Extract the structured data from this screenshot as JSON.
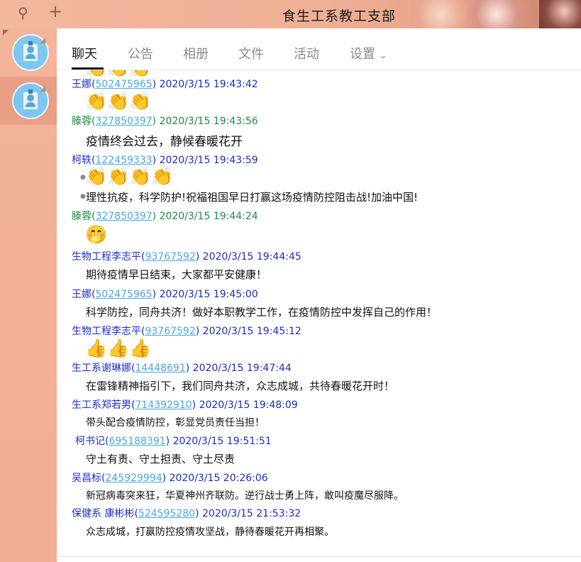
{
  "window": {
    "title": "食生工系教工支部"
  },
  "tools": {
    "search_icon": "⚲",
    "add_icon": "+"
  },
  "tabs": [
    {
      "label": "聊天"
    },
    {
      "label": "公告"
    },
    {
      "label": "相册"
    },
    {
      "label": "文件"
    },
    {
      "label": "活动"
    },
    {
      "label": "设置"
    }
  ],
  "messages": [
    {
      "sender": "王娜",
      "uid": "502475965",
      "time": "2020/3/15 19:43:42",
      "emoji": "👏👏👏"
    },
    {
      "sender": "滕蓉",
      "uid": "327850397",
      "time": "2020/3/15 19:43:56",
      "text": "疫情终会过去，静候春暖花开"
    },
    {
      "sender": "柯轶",
      "uid": "122459333",
      "time": "2020/3/15 19:43:59",
      "emoji": "👏👏👏👏",
      "text": "理性抗疫，科学防护!祝福祖国早日打赢这场疫情防控阻击战!加油中国!"
    },
    {
      "sender": "滕蓉",
      "uid": "327850397",
      "time": "2020/3/15 19:44:24",
      "emoji": "🤭"
    },
    {
      "sender": "生物工程李志平",
      "uid": "93767592",
      "time": "2020/3/15 19:44:45",
      "text": "期待疫情早日结束，大家都平安健康！"
    },
    {
      "sender": "王娜",
      "uid": "502475965",
      "time": "2020/3/15 19:45:00",
      "text": "科学防控，同舟共济！做好本职教学工作，在疫情防控中发挥自己的作用！"
    },
    {
      "sender": "生物工程李志平",
      "uid": "93767592",
      "time": "2020/3/15 19:45:12",
      "emoji": "👍👍👍"
    },
    {
      "sender": "生工系谢琳娜",
      "uid": "14448691",
      "time": "2020/3/15 19:47:44",
      "text": "在雷锋精神指引下，我们同舟共济，众志成城，共待春暖花开时！"
    },
    {
      "sender": "生工系郑若男",
      "uid": "714392910",
      "time": "2020/3/15 19:48:09",
      "text": "带头配合疫情防控，彰显党员责任当担！"
    },
    {
      "sender": "柯书记",
      "uid": "695188391",
      "time": "2020/3/15 19:51:51",
      "text": "守土有责、守土担责、守土尽责"
    },
    {
      "sender": "吴昌标",
      "uid": "245929994",
      "time": "2020/3/15 20:26:06",
      "text": "新冠病毒突来狂，华夏神州齐联防。逆行战士勇上阵，敢叫疫魔尽服降。"
    },
    {
      "sender": "保健系 康彬彬",
      "uid": "524595280",
      "time": "2020/3/15 21:53:32",
      "text": "众志成城，打赢防控疫情攻坚战，静待春暖花开再相聚。"
    }
  ],
  "colors": {
    "sender_blue": "#1a2ec9",
    "sender_green": "#1e8c43",
    "uid_link": "#4aa6e8",
    "sidebar": "#f3b49a"
  }
}
